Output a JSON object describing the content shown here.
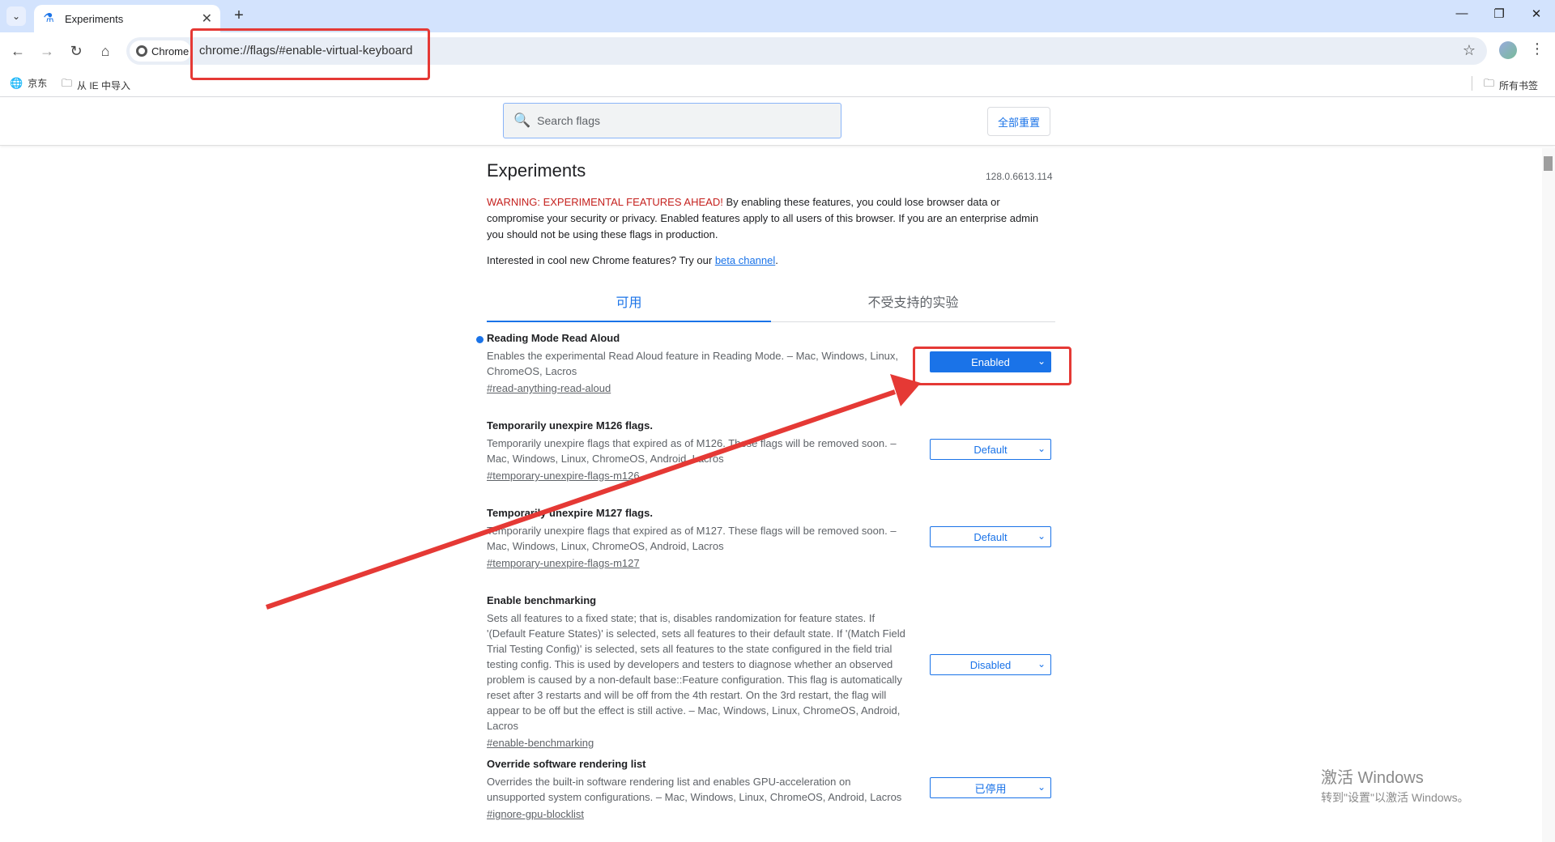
{
  "browser": {
    "tab_title": "Experiments",
    "omnibox_chip": "Chrome",
    "url": "chrome://flags/#enable-virtual-keyboard"
  },
  "bookmarks": {
    "items": [
      "京东",
      "从 IE 中导入"
    ],
    "all_bookmarks": "所有书签"
  },
  "flags": {
    "search_placeholder": "Search flags",
    "reset_all": "全部重置",
    "title": "Experiments",
    "version": "128.0.6613.114",
    "warning_red": "WARNING: EXPERIMENTAL FEATURES AHEAD!",
    "warning_text": " By enabling these features, you could lose browser data or compromise your security or privacy. Enabled features apply to all users of this browser. If you are an enterprise admin you should not be using these flags in production.",
    "beta_prefix": "Interested in cool new Chrome features? Try our ",
    "beta_link": "beta channel",
    "beta_suffix": ".",
    "tabs": [
      "可用",
      "不受支持的实验"
    ],
    "experiments": [
      {
        "title": "Reading Mode Read Aloud",
        "desc": "Enables the experimental Read Aloud feature in Reading Mode. – Mac, Windows, Linux, ChromeOS, Lacros",
        "link": "#read-anything-read-aloud",
        "value": "Enabled"
      },
      {
        "title": "Temporarily unexpire M126 flags.",
        "desc": "Temporarily unexpire flags that expired as of M126. These flags will be removed soon. – Mac, Windows, Linux, ChromeOS, Android, Lacros",
        "link": "#temporary-unexpire-flags-m126",
        "value": "Default"
      },
      {
        "title": "Temporarily unexpire M127 flags.",
        "desc": "Temporarily unexpire flags that expired as of M127. These flags will be removed soon. – Mac, Windows, Linux, ChromeOS, Android, Lacros",
        "link": "#temporary-unexpire-flags-m127",
        "value": "Default"
      },
      {
        "title": "Enable benchmarking",
        "desc": "Sets all features to a fixed state; that is, disables randomization for feature states. If '(Default Feature States)' is selected, sets all features to their default state. If '(Match Field Trial Testing Config)' is selected, sets all features to the state configured in the field trial testing config. This is used by developers and testers to diagnose whether an observed problem is caused by a non-default base::Feature configuration. This flag is automatically reset after 3 restarts and will be off from the 4th restart. On the 3rd restart, the flag will appear to be off but the effect is still active. – Mac, Windows, Linux, ChromeOS, Android, Lacros",
        "link": "#enable-benchmarking",
        "value": "Disabled"
      },
      {
        "title": "Override software rendering list",
        "desc": "Overrides the built-in software rendering list and enables GPU-acceleration on unsupported system configurations. – Mac, Windows, Linux, ChromeOS, Android, Lacros",
        "link": "#ignore-gpu-blocklist",
        "value": "已停用"
      }
    ]
  },
  "windows_activation": {
    "line1": "激活 Windows",
    "line2": "转到\"设置\"以激活 Windows。"
  },
  "colors": {
    "accent": "#1a73e8",
    "annotation": "#e53935"
  }
}
